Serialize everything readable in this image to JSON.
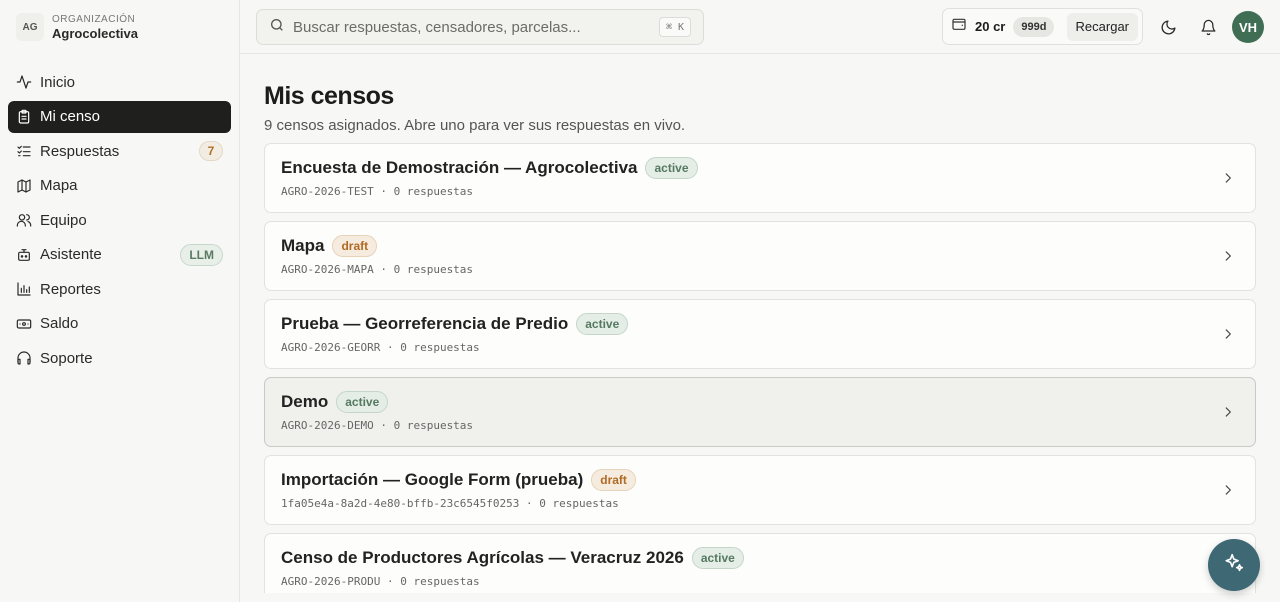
{
  "org": {
    "logo": "AG",
    "caption": "ORGANIZACIÓN",
    "name": "Agrocolectiva"
  },
  "sidebar": {
    "items": [
      {
        "label": "Inicio",
        "icon": "activity-icon"
      },
      {
        "label": "Mi censo",
        "icon": "clipboard-icon",
        "active": true
      },
      {
        "label": "Respuestas",
        "icon": "list-checks-icon",
        "badge": "7"
      },
      {
        "label": "Mapa",
        "icon": "map-icon"
      },
      {
        "label": "Equipo",
        "icon": "users-icon"
      },
      {
        "label": "Asistente",
        "icon": "bot-icon",
        "badge": "LLM"
      },
      {
        "label": "Reportes",
        "icon": "bar-chart-icon"
      },
      {
        "label": "Saldo",
        "icon": "banknote-icon"
      },
      {
        "label": "Soporte",
        "icon": "headphones-icon"
      }
    ]
  },
  "search": {
    "placeholder": "Buscar respuestas, censadores, parcelas...",
    "shortcut": "⌘ K"
  },
  "credits": {
    "amount": "20 cr",
    "days": "999d",
    "reload_label": "Recargar"
  },
  "user": {
    "initials": "VH"
  },
  "page": {
    "title": "Mis censos",
    "subtitle": "9 censos asignados. Abre uno para ver sus respuestas en vivo."
  },
  "censos": [
    {
      "title": "Encuesta de Demostración — Agrocolectiva",
      "status": "active",
      "meta": "AGRO-2026-TEST · 0 respuestas"
    },
    {
      "title": "Mapa",
      "status": "draft",
      "meta": "AGRO-2026-MAPA · 0 respuestas"
    },
    {
      "title": "Prueba — Georreferencia de Predio",
      "status": "active",
      "meta": "AGRO-2026-GEORR · 0 respuestas"
    },
    {
      "title": "Demo",
      "status": "active",
      "meta": "AGRO-2026-DEMO · 0 respuestas"
    },
    {
      "title": "Importación — Google Form (prueba)",
      "status": "draft",
      "meta": "1fa05e4a-8a2d-4e80-bffb-23c6545f0253 · 0 respuestas"
    },
    {
      "title": "Censo de Productores Agrícolas — Veracruz 2026",
      "status": "active",
      "meta": "AGRO-2026-PRODU · 0 respuestas"
    }
  ],
  "colors": {
    "accent_dark": "#1f1f1d",
    "avatar_green": "#3f6e55",
    "fab_teal": "#3d6874",
    "active_badge": "#557a60",
    "draft_badge": "#b06a24"
  }
}
